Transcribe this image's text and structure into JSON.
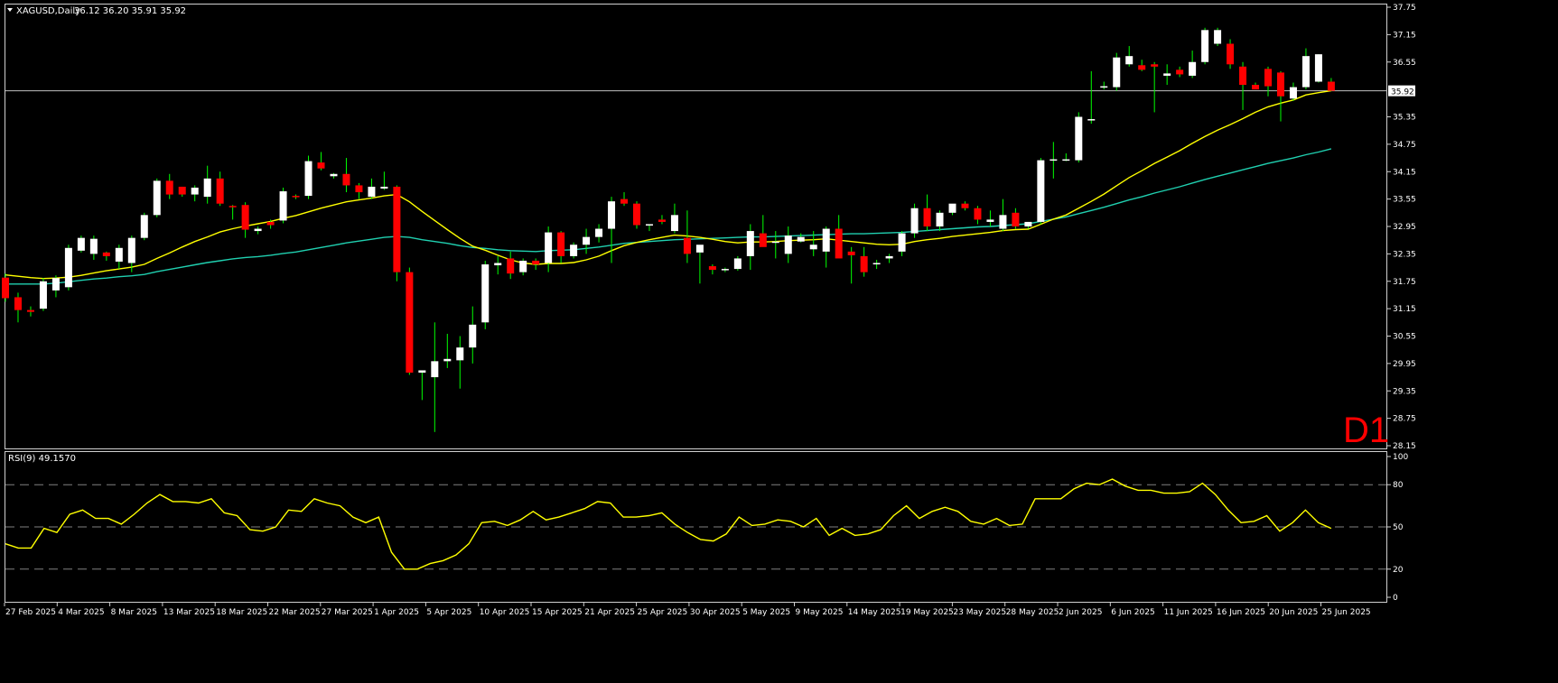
{
  "chart_data": [
    {
      "type": "candlestick",
      "title": "XAGUSD,Daily",
      "ohlc_label": "36.12 36.20 35.91 35.92",
      "timeframe_label": "D1",
      "ylim": [
        28.15,
        37.75
      ],
      "y_ticks": [
        "37.75",
        "37.15",
        "36.55",
        "35.92",
        "35.35",
        "34.75",
        "34.15",
        "33.55",
        "32.95",
        "32.35",
        "31.75",
        "31.15",
        "30.55",
        "29.95",
        "29.35",
        "28.75",
        "28.15"
      ],
      "current_price": 35.92,
      "x_tick_labels": [
        "27 Feb 2025",
        "4 Mar 2025",
        "8 Mar 2025",
        "13 Mar 2025",
        "18 Mar 2025",
        "22 Mar 2025",
        "27 Mar 2025",
        "1 Apr 2025",
        "5 Apr 2025",
        "10 Apr 2025",
        "15 Apr 2025",
        "21 Apr 2025",
        "25 Apr 2025",
        "30 Apr 2025",
        "5 May 2025",
        "9 May 2025",
        "14 May 2025",
        "19 May 2025",
        "23 May 2025",
        "28 May 2025",
        "2 Jun 2025",
        "6 Jun 2025",
        "11 Jun 2025",
        "16 Jun 2025",
        "20 Jun 2025",
        "25 Jun 2025"
      ],
      "colors": {
        "background": "#000000",
        "bull": "#ffffff",
        "bear": "#ff0000",
        "wick": "#00ff00",
        "ma_fast": "#ffff00",
        "ma_slow": "#20d0b0",
        "grid_line": "#c0c0c0"
      },
      "candles": [
        [
          31.83,
          31.92,
          31.3,
          31.38
        ],
        [
          31.4,
          31.5,
          30.85,
          31.12
        ],
        [
          31.12,
          31.2,
          30.98,
          31.08
        ],
        [
          31.15,
          31.82,
          31.1,
          31.75
        ],
        [
          31.55,
          31.88,
          31.4,
          31.82
        ],
        [
          31.62,
          32.55,
          31.55,
          32.48
        ],
        [
          32.42,
          32.75,
          32.38,
          32.7
        ],
        [
          32.35,
          32.75,
          32.22,
          32.68
        ],
        [
          32.38,
          32.4,
          32.2,
          32.3
        ],
        [
          32.18,
          32.55,
          32.02,
          32.48
        ],
        [
          32.15,
          32.75,
          31.95,
          32.7
        ],
        [
          32.7,
          33.25,
          32.65,
          33.2
        ],
        [
          33.2,
          34.0,
          33.15,
          33.95
        ],
        [
          33.95,
          34.1,
          33.55,
          33.65
        ],
        [
          33.82,
          33.82,
          33.6,
          33.65
        ],
        [
          33.65,
          33.85,
          33.5,
          33.8
        ],
        [
          33.6,
          34.28,
          33.45,
          34.0
        ],
        [
          34.0,
          34.15,
          33.4,
          33.45
        ],
        [
          33.4,
          33.42,
          33.1,
          33.38
        ],
        [
          33.42,
          33.48,
          32.7,
          32.88
        ],
        [
          32.85,
          32.95,
          32.78,
          32.9
        ],
        [
          33.05,
          33.1,
          32.9,
          32.98
        ],
        [
          33.08,
          33.8,
          33.02,
          33.72
        ],
        [
          33.62,
          33.65,
          33.55,
          33.6
        ],
        [
          33.62,
          34.5,
          33.55,
          34.38
        ],
        [
          34.35,
          34.58,
          34.18,
          34.22
        ],
        [
          34.05,
          34.12,
          34.0,
          34.1
        ],
        [
          34.1,
          34.45,
          33.7,
          33.85
        ],
        [
          33.85,
          33.9,
          33.55,
          33.7
        ],
        [
          33.6,
          34.0,
          33.55,
          33.82
        ],
        [
          33.78,
          34.15,
          33.75,
          33.82
        ],
        [
          33.82,
          33.85,
          31.75,
          31.95
        ],
        [
          31.95,
          32.05,
          29.7,
          29.75
        ],
        [
          29.75,
          29.78,
          29.15,
          29.8
        ],
        [
          29.65,
          30.85,
          28.45,
          30.0
        ],
        [
          30.0,
          30.6,
          29.85,
          30.05
        ],
        [
          30.02,
          30.55,
          29.4,
          30.3
        ],
        [
          30.3,
          31.2,
          29.95,
          30.8
        ],
        [
          30.85,
          32.2,
          30.7,
          32.12
        ],
        [
          32.1,
          32.3,
          31.9,
          32.15
        ],
        [
          32.25,
          32.4,
          31.8,
          31.92
        ],
        [
          31.95,
          32.25,
          31.88,
          32.2
        ],
        [
          32.2,
          32.25,
          32.0,
          32.12
        ],
        [
          32.15,
          32.95,
          31.95,
          32.82
        ],
        [
          32.82,
          32.85,
          32.15,
          32.3
        ],
        [
          32.3,
          32.6,
          32.25,
          32.55
        ],
        [
          32.55,
          32.9,
          32.35,
          32.72
        ],
        [
          32.72,
          33.0,
          32.6,
          32.9
        ],
        [
          32.9,
          33.6,
          32.15,
          33.5
        ],
        [
          33.55,
          33.7,
          33.4,
          33.45
        ],
        [
          33.45,
          33.5,
          32.9,
          32.98
        ],
        [
          32.98,
          33.0,
          32.85,
          33.0
        ],
        [
          33.1,
          33.2,
          33.0,
          33.05
        ],
        [
          32.85,
          33.45,
          32.8,
          33.2
        ],
        [
          32.7,
          33.3,
          32.15,
          32.35
        ],
        [
          32.38,
          32.4,
          31.7,
          32.55
        ],
        [
          32.08,
          32.12,
          31.9,
          32.0
        ],
        [
          32.02,
          32.05,
          31.95,
          32.02
        ],
        [
          32.02,
          32.3,
          31.98,
          32.25
        ],
        [
          32.3,
          33.0,
          32.0,
          32.85
        ],
        [
          32.8,
          33.2,
          32.55,
          32.5
        ],
        [
          32.6,
          32.85,
          32.25,
          32.62
        ],
        [
          32.35,
          32.95,
          32.15,
          32.75
        ],
        [
          32.62,
          32.8,
          32.6,
          32.72
        ],
        [
          32.45,
          32.85,
          32.3,
          32.55
        ],
        [
          32.4,
          32.95,
          32.05,
          32.9
        ],
        [
          32.9,
          33.2,
          32.35,
          32.25
        ],
        [
          32.4,
          32.5,
          31.7,
          32.32
        ],
        [
          32.3,
          32.5,
          31.85,
          31.95
        ],
        [
          32.12,
          32.22,
          32.02,
          32.15
        ],
        [
          32.25,
          32.35,
          32.15,
          32.3
        ],
        [
          32.4,
          32.85,
          32.3,
          32.8
        ],
        [
          32.8,
          33.45,
          32.7,
          33.35
        ],
        [
          33.35,
          33.65,
          32.85,
          32.95
        ],
        [
          32.95,
          33.3,
          32.85,
          33.25
        ],
        [
          33.25,
          33.4,
          33.2,
          33.45
        ],
        [
          33.45,
          33.5,
          33.3,
          33.35
        ],
        [
          33.35,
          33.4,
          33.0,
          33.1
        ],
        [
          33.05,
          33.3,
          32.95,
          33.1
        ],
        [
          32.9,
          33.55,
          32.85,
          33.2
        ],
        [
          33.25,
          33.35,
          32.9,
          32.95
        ],
        [
          32.95,
          33.05,
          32.9,
          33.05
        ],
        [
          33.05,
          34.45,
          33.0,
          34.4
        ],
        [
          34.4,
          34.8,
          34.0,
          34.42
        ],
        [
          34.4,
          34.55,
          34.38,
          34.42
        ],
        [
          34.4,
          35.45,
          34.35,
          35.35
        ],
        [
          35.3,
          36.35,
          35.2,
          35.3
        ],
        [
          36.02,
          36.12,
          35.95,
          36.02
        ],
        [
          36.0,
          36.75,
          35.92,
          36.65
        ],
        [
          36.5,
          36.9,
          36.45,
          36.68
        ],
        [
          36.48,
          36.6,
          36.35,
          36.38
        ],
        [
          36.5,
          36.55,
          35.45,
          36.45
        ],
        [
          36.25,
          36.5,
          36.05,
          36.3
        ],
        [
          36.38,
          36.45,
          36.22,
          36.28
        ],
        [
          36.25,
          36.8,
          36.2,
          36.55
        ],
        [
          36.55,
          37.3,
          36.5,
          37.25
        ],
        [
          36.95,
          37.3,
          36.9,
          37.25
        ],
        [
          36.95,
          37.05,
          36.4,
          36.5
        ],
        [
          36.45,
          36.55,
          35.5,
          36.05
        ],
        [
          36.05,
          36.1,
          35.95,
          35.95
        ],
        [
          36.4,
          36.45,
          35.8,
          36.02
        ],
        [
          36.32,
          36.35,
          35.25,
          35.8
        ],
        [
          35.75,
          36.1,
          35.7,
          36.0
        ],
        [
          36.0,
          36.85,
          35.95,
          36.68
        ],
        [
          36.12,
          36.72,
          36.1,
          36.72
        ],
        [
          36.12,
          36.2,
          35.91,
          35.92
        ]
      ],
      "ma_fast": [
        31.89,
        31.86,
        31.83,
        31.81,
        31.82,
        31.84,
        31.88,
        31.93,
        31.98,
        32.02,
        32.06,
        32.12,
        32.25,
        32.37,
        32.5,
        32.62,
        32.72,
        32.83,
        32.9,
        32.96,
        33.01,
        33.06,
        33.13,
        33.19,
        33.27,
        33.35,
        33.42,
        33.49,
        33.53,
        33.57,
        33.62,
        33.65,
        33.49,
        33.28,
        33.08,
        32.88,
        32.69,
        32.52,
        32.43,
        32.32,
        32.22,
        32.15,
        32.12,
        32.14,
        32.14,
        32.16,
        32.22,
        32.3,
        32.42,
        32.53,
        32.6,
        32.66,
        32.71,
        32.76,
        32.74,
        32.71,
        32.67,
        32.62,
        32.59,
        32.61,
        32.61,
        32.62,
        32.64,
        32.65,
        32.66,
        32.68,
        32.65,
        32.62,
        32.59,
        32.56,
        32.55,
        32.56,
        32.62,
        32.66,
        32.69,
        32.73,
        32.76,
        32.79,
        32.82,
        32.86,
        32.88,
        32.89,
        33.0,
        33.11,
        33.2,
        33.35,
        33.5,
        33.66,
        33.84,
        34.02,
        34.17,
        34.33,
        34.47,
        34.61,
        34.77,
        34.92,
        35.06,
        35.18,
        35.31,
        35.45,
        35.57,
        35.65,
        35.72,
        35.83,
        35.88,
        35.92
      ],
      "ma_slow": [
        31.69,
        31.69,
        31.69,
        31.69,
        31.71,
        31.74,
        31.77,
        31.8,
        31.82,
        31.85,
        31.87,
        31.9,
        31.96,
        32.01,
        32.06,
        32.11,
        32.16,
        32.2,
        32.24,
        32.27,
        32.29,
        32.32,
        32.36,
        32.39,
        32.44,
        32.49,
        32.54,
        32.59,
        32.63,
        32.67,
        32.71,
        32.73,
        32.71,
        32.66,
        32.62,
        32.58,
        32.53,
        32.49,
        32.47,
        32.44,
        32.42,
        32.41,
        32.4,
        32.42,
        32.43,
        32.44,
        32.47,
        32.5,
        32.54,
        32.58,
        32.6,
        32.62,
        32.64,
        32.66,
        32.67,
        32.68,
        32.69,
        32.7,
        32.71,
        32.72,
        32.72,
        32.73,
        32.74,
        32.75,
        32.76,
        32.77,
        32.78,
        32.79,
        32.79,
        32.8,
        32.81,
        32.82,
        32.84,
        32.86,
        32.88,
        32.9,
        32.92,
        32.94,
        32.95,
        32.97,
        32.99,
        33.01,
        33.06,
        33.11,
        33.16,
        33.23,
        33.3,
        33.37,
        33.45,
        33.53,
        33.6,
        33.68,
        33.75,
        33.82,
        33.9,
        33.98,
        34.05,
        34.12,
        34.19,
        34.26,
        34.33,
        34.39,
        34.45,
        34.52,
        34.58,
        34.65
      ]
    },
    {
      "type": "line",
      "title": "RSI(9) 49.1570",
      "ylim": [
        0,
        100
      ],
      "y_ticks": [
        "100",
        "80",
        "50",
        "20",
        "0"
      ],
      "levels": [
        80,
        50,
        20
      ],
      "colors": {
        "line": "#ffff00",
        "level": "#808080"
      },
      "values": [
        38,
        35,
        35,
        49,
        46,
        59,
        62,
        56,
        56,
        52,
        59,
        67,
        73,
        68,
        68,
        67,
        70,
        60,
        58,
        48,
        47,
        50,
        62,
        61,
        70,
        67,
        65,
        57,
        53,
        57,
        32,
        20,
        20,
        24,
        26,
        30,
        38,
        53,
        54,
        51,
        55,
        61,
        55,
        57,
        60,
        63,
        68,
        67,
        57,
        57,
        58,
        60,
        52,
        46,
        41,
        40,
        45,
        57,
        51,
        52,
        55,
        54,
        50,
        56,
        44,
        49,
        44,
        45,
        48,
        58,
        65,
        56,
        61,
        64,
        61,
        54,
        52,
        56,
        51,
        52,
        70,
        70,
        70,
        77,
        81,
        80,
        84,
        79,
        76,
        76,
        74,
        74,
        75,
        81,
        73,
        62,
        53,
        54,
        58,
        47,
        53,
        62,
        53,
        49
      ]
    }
  ]
}
